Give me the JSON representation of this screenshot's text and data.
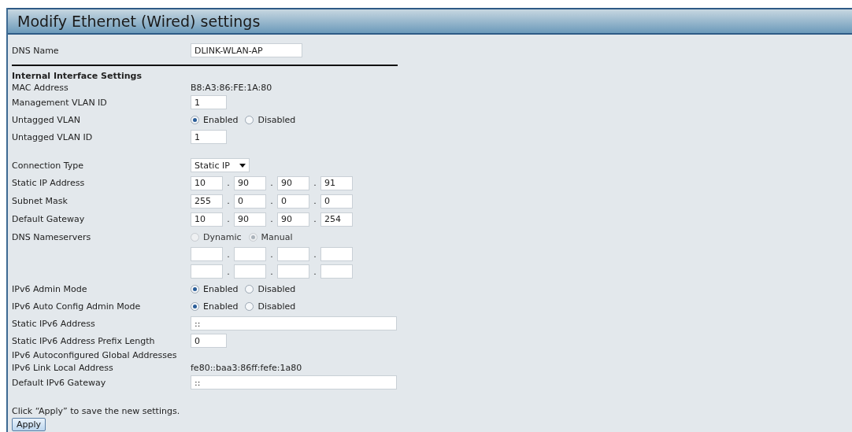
{
  "title": "Modify Ethernet (Wired) settings",
  "dns_name": {
    "label": "DNS Name",
    "value": "DLINK-WLAN-AP"
  },
  "section": "Internal Interface Settings",
  "interface_rows": [
    {
      "kind": "static",
      "label": "MAC Address",
      "value": "B8:A3:86:FE:1A:80"
    },
    {
      "kind": "field",
      "label": "Management VLAN ID",
      "value": "1"
    },
    {
      "kind": "radio",
      "label": "Untagged VLAN",
      "disabled": false,
      "options": [
        {
          "label": "Enabled",
          "selected": true
        },
        {
          "label": "Disabled",
          "selected": false
        }
      ]
    },
    {
      "kind": "field",
      "label": "Untagged VLAN ID",
      "value": "1"
    }
  ],
  "connection_rows": [
    {
      "kind": "select",
      "label": "Connection Type",
      "value": "Static IP"
    },
    {
      "kind": "ip",
      "label": "Static IP Address",
      "separator": ".",
      "octets": [
        "10",
        "90",
        "90",
        "91"
      ]
    },
    {
      "kind": "ip",
      "label": "Subnet Mask",
      "separator": ".",
      "octets": [
        "255",
        "0",
        "0",
        "0"
      ]
    },
    {
      "kind": "ip",
      "label": "Default Gateway",
      "separator": ".",
      "octets": [
        "10",
        "90",
        "90",
        "254"
      ]
    },
    {
      "kind": "radio",
      "label": "DNS Nameservers",
      "disabled": true,
      "options": [
        {
          "label": "Dynamic",
          "selected": false
        },
        {
          "label": "Manual",
          "selected": true
        }
      ]
    },
    {
      "kind": "blank_ip",
      "separator": "."
    },
    {
      "kind": "blank_ip",
      "separator": "."
    },
    {
      "kind": "radio",
      "label": "IPv6 Admin Mode",
      "disabled": false,
      "options": [
        {
          "label": "Enabled",
          "selected": true
        },
        {
          "label": "Disabled",
          "selected": false
        }
      ]
    },
    {
      "kind": "radio",
      "label": "IPv6 Auto Config Admin Mode",
      "disabled": false,
      "options": [
        {
          "label": "Enabled",
          "selected": true
        },
        {
          "label": "Disabled",
          "selected": false
        }
      ]
    },
    {
      "kind": "wide_field",
      "label": "Static IPv6 Address",
      "value": "::"
    },
    {
      "kind": "field",
      "label": "Static IPv6 Address Prefix Length",
      "value": "0"
    },
    {
      "kind": "text",
      "label": "IPv6 Autoconfigured Global Addresses"
    },
    {
      "kind": "static",
      "label": "IPv6 Link Local Address",
      "value": "fe80::baa3:86ff:fefe:1a80"
    },
    {
      "kind": "wide_field",
      "label": "Default IPv6 Gateway",
      "value": "::"
    }
  ],
  "note": "Click “Apply” to save the new settings.",
  "apply_button": "Apply"
}
